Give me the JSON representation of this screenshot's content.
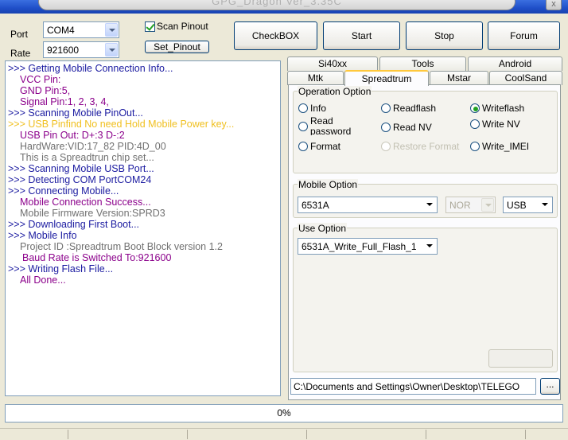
{
  "window": {
    "title": "GPG_Dragon Ver_3.35C",
    "close_glyph": "x"
  },
  "connection": {
    "port_label": "Port",
    "port_value": "COM4",
    "rate_label": "Rate",
    "rate_value": "921600",
    "scan_pinout_label": "Scan Pinout",
    "scan_pinout_checked": true,
    "set_pinout_label": "Set_Pinout"
  },
  "toolbar": {
    "checkbox_label": "CheckBOX",
    "start_label": "Start",
    "stop_label": "Stop",
    "forum_label": "Forum"
  },
  "log": [
    {
      "text": ">>> Getting Mobile Connection Info...",
      "color": "navy",
      "indent": 0
    },
    {
      "text": "VCC Pin:",
      "color": "purple",
      "indent": 1
    },
    {
      "text": "GND Pin:5,",
      "color": "purple",
      "indent": 1
    },
    {
      "text": "Signal Pin:1, 2, 3, 4,",
      "color": "purple",
      "indent": 1
    },
    {
      "text": ">>> Scanning Mobile PinOut...",
      "color": "navy",
      "indent": 0
    },
    {
      "text": ">>> USB Pinfind No need Hold Mobile Power key...",
      "color": "yellow",
      "indent": 0
    },
    {
      "text": "USB Pin Out: D+:3  D-:2",
      "color": "purple",
      "indent": 1
    },
    {
      "text": "HardWare:VID:17_82 PID:4D_00",
      "color": "gray",
      "indent": 1
    },
    {
      "text": "This is a Spreadtrun chip set...",
      "color": "gray",
      "indent": 1
    },
    {
      "text": ">>> Scanning Mobile USB Port...",
      "color": "navy",
      "indent": 0
    },
    {
      "text": ">>> Detecting COM PortCOM24",
      "color": "navy",
      "indent": 0
    },
    {
      "text": ">>> Connecting Mobile...",
      "color": "navy",
      "indent": 0
    },
    {
      "text": "Mobile Connection Success...",
      "color": "purple",
      "indent": 1
    },
    {
      "text": "Mobile Firmware Version:SPRD3",
      "color": "gray",
      "indent": 1
    },
    {
      "text": ">>> Downloading First Boot...",
      "color": "navy",
      "indent": 0
    },
    {
      "text": ">>> Mobile Info",
      "color": "navy",
      "indent": 0
    },
    {
      "text": "Project ID :Spreadtrum Boot Block version 1.2",
      "color": "gray",
      "indent": 1
    },
    {
      "text": "Baud Rate is Switched To:921600",
      "color": "purple",
      "indent": 2
    },
    {
      "text": ">>> Writing Flash File...",
      "color": "navy",
      "indent": 0
    },
    {
      "text": "All Done...",
      "color": "purple",
      "indent": 1
    }
  ],
  "colors": {
    "navy": "#1a1aa0",
    "purple": "#8b008b",
    "yellow": "#f0c020",
    "gray": "#707070"
  },
  "tabs": {
    "row1": [
      "Si40xx",
      "Tools",
      "Android"
    ],
    "row2": [
      "Mtk",
      "Spreadtrum",
      "Mstar",
      "CoolSand"
    ],
    "active": "Spreadtrum"
  },
  "operation": {
    "title": "Operation Option",
    "options": [
      {
        "label": "Info",
        "selected": false,
        "disabled": false
      },
      {
        "label": "Readflash",
        "selected": false,
        "disabled": false
      },
      {
        "label": "Writeflash",
        "selected": true,
        "disabled": false
      },
      {
        "label": "Read password",
        "selected": false,
        "disabled": false
      },
      {
        "label": "Read NV",
        "selected": false,
        "disabled": false
      },
      {
        "label": "Write NV",
        "selected": false,
        "disabled": false
      },
      {
        "label": "Format",
        "selected": false,
        "disabled": false
      },
      {
        "label": "Restore Format",
        "selected": false,
        "disabled": true
      },
      {
        "label": "Write_IMEI",
        "selected": false,
        "disabled": false
      }
    ]
  },
  "mobile_option": {
    "title": "Mobile Option",
    "model": "6531A",
    "memory": "NOR",
    "interface": "USB"
  },
  "use_option": {
    "title": "Use Option",
    "value": "6531A_Write_Full_Flash_1"
  },
  "file": {
    "path": "C:\\Documents and Settings\\Owner\\Desktop\\TELEGO",
    "browse_label": "..."
  },
  "progress": {
    "percent": 0,
    "label": "0%"
  }
}
